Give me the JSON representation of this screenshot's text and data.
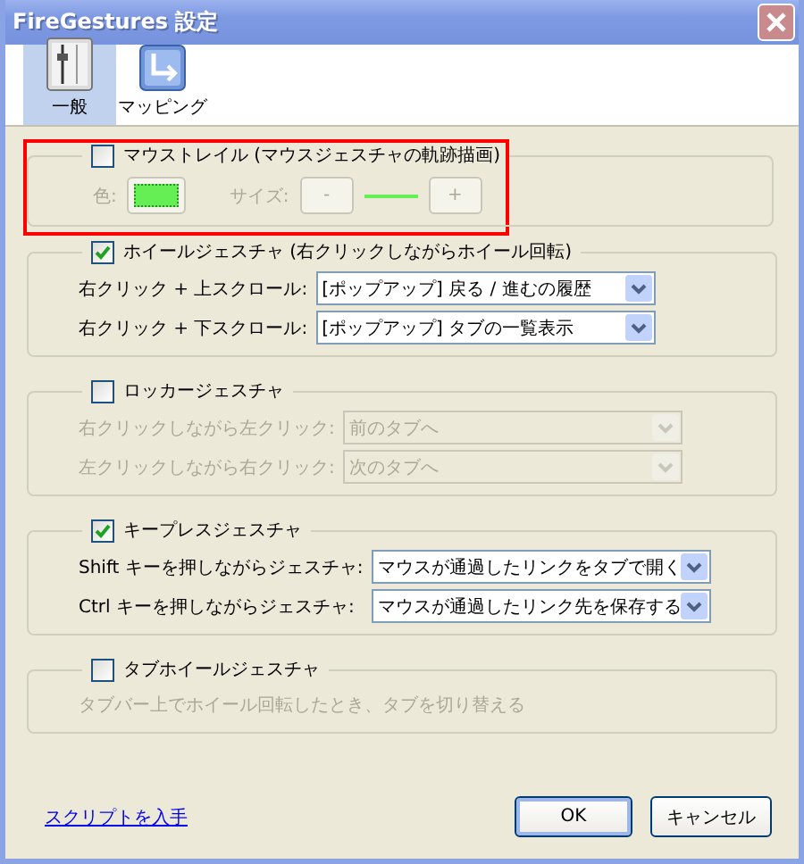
{
  "window": {
    "title": "FireGestures 設定"
  },
  "toolbar": [
    {
      "kind": "general",
      "label": "一般",
      "selected": true
    },
    {
      "kind": "mapping",
      "label": "マッピング",
      "selected": false
    }
  ],
  "groups": [
    {
      "kind": "trail",
      "title": "マウストレイル (マウスジェスチャの軌跡描画)",
      "checked": false,
      "highlighted": true,
      "color_label": "色:",
      "color": "#66ee55",
      "size_label": "サイズ:",
      "minus": "-",
      "plus": "+"
    },
    {
      "kind": "selects",
      "title": "ホイールジェスチャ (右クリックしながらホイール回転)",
      "checked": true,
      "highlighted": false,
      "rows": [
        {
          "label": "右クリック + 上スクロール:",
          "value": "[ポップアップ] 戻る / 進むの履歴"
        },
        {
          "label": "右クリック + 下スクロール:",
          "value": "[ポップアップ] タブの一覧表示"
        }
      ]
    },
    {
      "kind": "selects",
      "title": "ロッカージェスチャ",
      "checked": false,
      "highlighted": false,
      "rows": [
        {
          "label": "右クリックしながら左クリック:",
          "value": "前のタブへ"
        },
        {
          "label": "左クリックしながら右クリック:",
          "value": "次のタブへ"
        }
      ]
    },
    {
      "kind": "selects",
      "title": "キープレスジェスチャ",
      "checked": true,
      "highlighted": false,
      "rows": [
        {
          "label": "Shift キーを押しながらジェスチャ:",
          "value": "マウスが通過したリンクをタブで開く"
        },
        {
          "label": "Ctrl キーを押しながらジェスチャ:",
          "value": "マウスが通過したリンク先を保存する"
        }
      ]
    },
    {
      "kind": "text",
      "title": "タブホイールジェスチャ",
      "checked": false,
      "highlighted": false,
      "text": "タブバー上でホイール回転したとき、タブを切り替える"
    }
  ],
  "footer": {
    "link": "スクリプトを入手",
    "buttons": [
      {
        "label": "OK",
        "default": true
      },
      {
        "label": "キャンセル",
        "default": false
      }
    ]
  }
}
